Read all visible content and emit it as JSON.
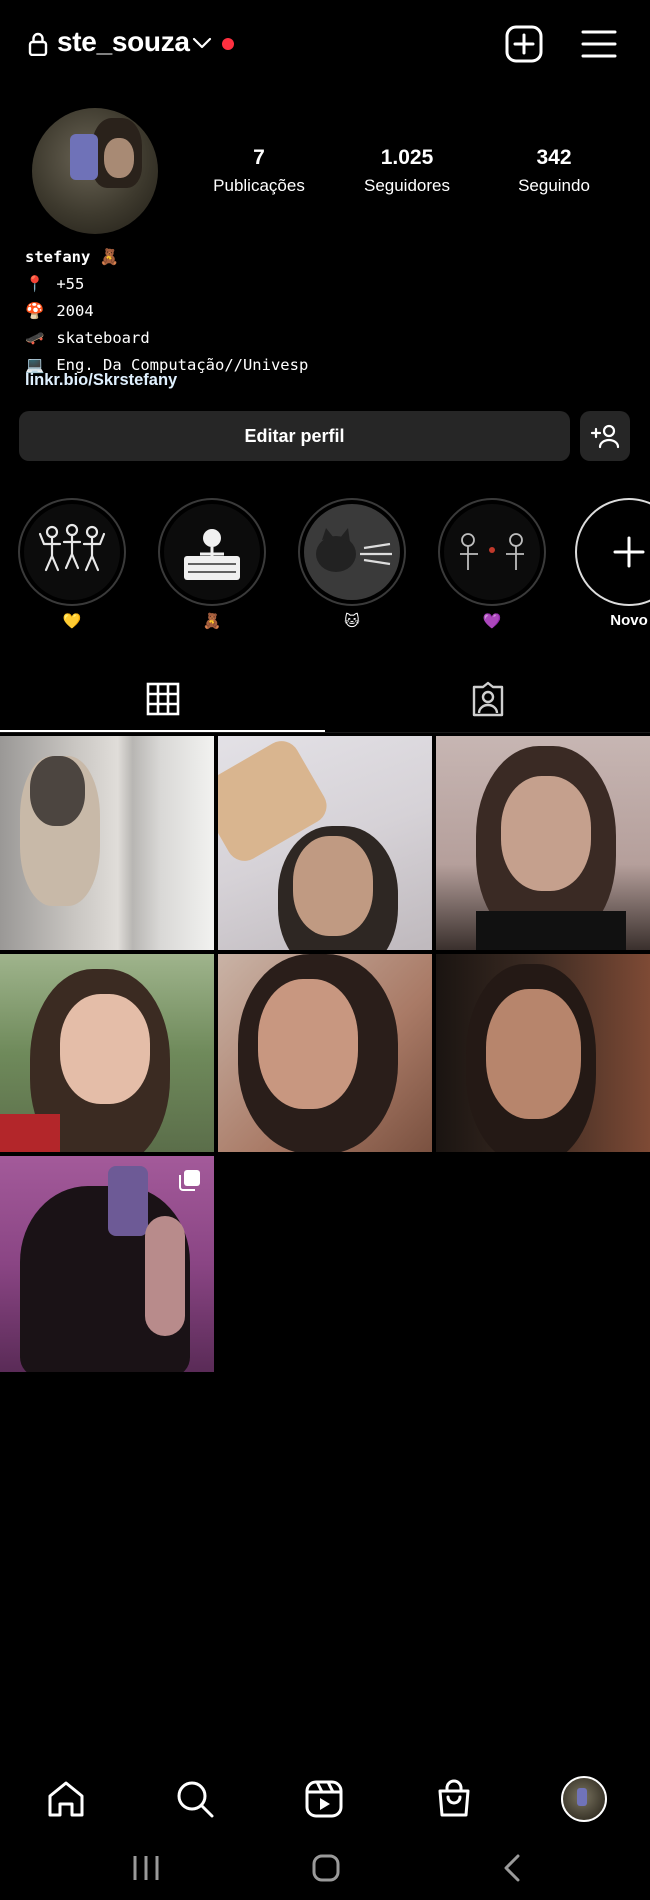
{
  "header": {
    "username": "ste_souza",
    "icons": [
      "lock-icon",
      "chevron-down-icon",
      "create-plus-icon",
      "menu-icon"
    ],
    "notification_dot_color": "#ff3040"
  },
  "profile": {
    "stats": [
      {
        "value": "7",
        "label": "Publicações"
      },
      {
        "value": "1.025",
        "label": "Seguidores"
      },
      {
        "value": "342",
        "label": "Seguindo"
      }
    ],
    "bio": {
      "name": "stefany",
      "name_emoji": "🧸",
      "lines": [
        {
          "emoji": "📍",
          "text": "+55"
        },
        {
          "emoji": "🍄",
          "text": "2004"
        },
        {
          "emoji": "🛹",
          "text": "skateboard"
        },
        {
          "emoji": "💻",
          "text": "Eng. Da Computação//Univesp"
        }
      ]
    },
    "link": "linkr.bio/Skrstefany",
    "edit_button": "Editar perfil"
  },
  "highlights": [
    {
      "caption": "💛"
    },
    {
      "caption": "🧸"
    },
    {
      "caption": "🐱"
    },
    {
      "caption": "💜"
    },
    {
      "caption": "Novo"
    }
  ],
  "tabs": [
    {
      "icon": "grid-icon",
      "active": true
    },
    {
      "icon": "tagged-icon",
      "active": false
    }
  ],
  "posts_count_shown": 7,
  "bottom_nav": [
    "home-icon",
    "search-icon",
    "reels-icon",
    "shop-icon",
    "profile-avatar"
  ],
  "system_nav": [
    "recent-apps-icon",
    "home-button-icon",
    "back-icon"
  ]
}
